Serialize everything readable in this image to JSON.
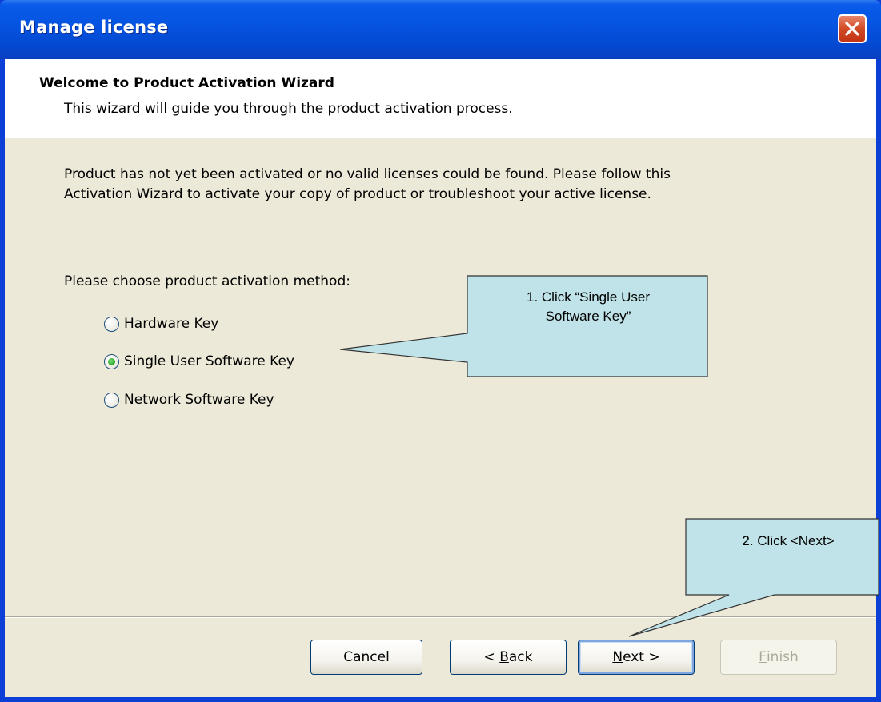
{
  "window": {
    "title": "Manage license"
  },
  "header": {
    "title": "Welcome to Product Activation Wizard",
    "subtitle": "This wizard will guide you through the product activation process."
  },
  "main": {
    "message_line1": "Product has not yet been activated or no valid licenses could be found. Please follow this",
    "message_line2": "Activation Wizard to activate your copy of product or troubleshoot your active license.",
    "choose_label": "Please choose product activation method:",
    "options": [
      {
        "label": "Hardware Key",
        "selected": false
      },
      {
        "label": "Single User Software Key",
        "selected": true
      },
      {
        "label": "Network Software Key",
        "selected": false
      }
    ]
  },
  "buttons": {
    "cancel": "Cancel",
    "back_prefix": "< ",
    "back_key": "B",
    "back_rest": "ack",
    "next_key": "N",
    "next_rest": "ext >",
    "finish_key": "F",
    "finish_rest": "inish"
  },
  "callouts": {
    "step1_line1": "1. Click “Single User",
    "step1_line2": "Software Key”",
    "step2": "2. Click <Next>"
  },
  "colors": {
    "titlebar": "#0553e0",
    "dialog_bg": "#ece9d8",
    "callout_fill": "#bfe3e8",
    "radio_selected": "#21a121"
  }
}
